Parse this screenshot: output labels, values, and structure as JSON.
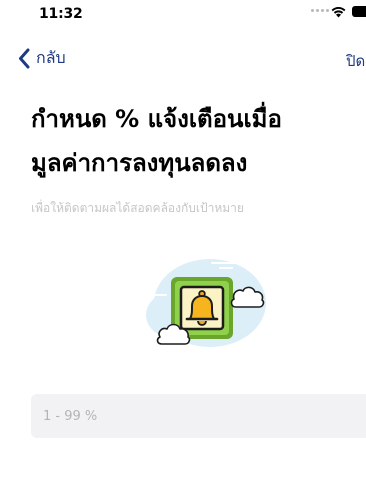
{
  "status_bar": {
    "time": "11:32",
    "icons": [
      "signal-dots-icon",
      "wifi-icon",
      "battery-icon"
    ]
  },
  "nav": {
    "back_label": "กลับ",
    "close_label": "ปิด",
    "back_icon": "chevron-left-icon",
    "accent_color": "#1f3a82"
  },
  "page": {
    "title_line1": "กำหนด % แจ้งเตือนเมื่อ",
    "title_line2": "มูลค่าการลงทุนลดลง",
    "subtitle": "เพื่อให้ติดตามผลได้สอดคล้องกับเป้าหมาย"
  },
  "illustration": {
    "icon": "bell-notification-icon",
    "colors": {
      "frame": "#7cbf3c",
      "bell": "#f2a81d",
      "cloud": "#cfe9f6"
    }
  },
  "input": {
    "placeholder": "1 - 99 %",
    "value": ""
  }
}
